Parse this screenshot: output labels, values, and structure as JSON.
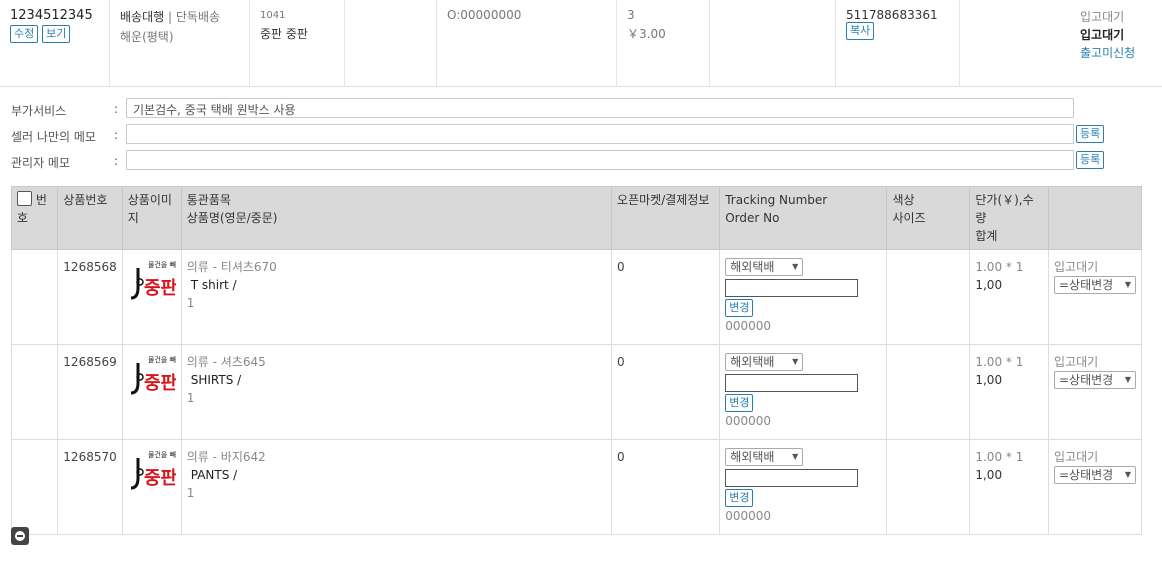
{
  "order": {
    "order_id": "1234512345",
    "edit_label": "수정",
    "view_label": "보기",
    "shipping_type": "배송대행",
    "shipping_mode": "단독배송",
    "shipping_route": "해운(평택)",
    "code": "1041",
    "seller": "중판 중판",
    "order_no": "O:00000000",
    "quantity": "3",
    "amount": "￥3.00",
    "tracking": "511788683361",
    "copy_label": "복사",
    "status_top": "입고대기",
    "status_bold": "입고대기",
    "status_link": "출고미신청"
  },
  "services": {
    "extra_label": "부가서비스",
    "extra_value": "기본검수, 중국 택배 원박스 사용",
    "seller_memo_label": "셀러 나만의 메모",
    "admin_memo_label": "관리자 메모",
    "colon": ":",
    "register_label": "등록"
  },
  "table": {
    "headers": {
      "num": "번호",
      "product_no": "상품번호",
      "product_img": "상품이미지",
      "customs_item": "통관품목",
      "product_name": "상품명(영문/중문)",
      "market": "오픈마켓/결제정보",
      "tracking": "Tracking Number",
      "order_no": "Order No",
      "color": "색상",
      "size": "사이즈",
      "price_qty": "단가(￥),수량",
      "total": "합계"
    },
    "rows": [
      {
        "product_no": "1268568",
        "customs": "의류 - 티셔츠670",
        "name": "T shirt /",
        "qty": "1",
        "market": "0",
        "carrier": "해외택배",
        "change_label": "변경",
        "order_no": "000000",
        "price_line": "1.00 * 1",
        "total": "1,00",
        "status": "입고대기",
        "status_select": "=상태변경"
      },
      {
        "product_no": "1268569",
        "customs": "의류 - 셔츠645",
        "name": "SHIRTS /",
        "qty": "1",
        "market": "0",
        "carrier": "해외택배",
        "change_label": "변경",
        "order_no": "000000",
        "price_line": "1.00 * 1",
        "total": "1,00",
        "status": "입고대기",
        "status_select": "=상태변경"
      },
      {
        "product_no": "1268570",
        "customs": "의류 - 바지642",
        "name": "PANTS /",
        "qty": "1",
        "market": "0",
        "carrier": "해외택배",
        "change_label": "변경",
        "order_no": "000000",
        "price_line": "1.00 * 1",
        "total": "1,00",
        "status": "입고대기",
        "status_select": "=상태변경"
      }
    ]
  },
  "logo": {
    "top_text": "물건을 빼다",
    "main_text": "중판"
  },
  "colors": {
    "accent": "#2b7fb0",
    "header_bg": "#d9d9d9",
    "logo_red": "#d6161b"
  }
}
